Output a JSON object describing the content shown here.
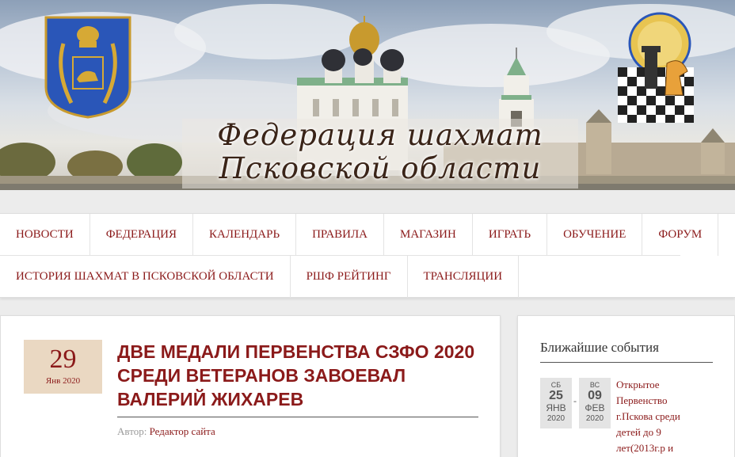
{
  "banner": {
    "title_line1": "Федерация шахмат",
    "title_line2": "Псковской области"
  },
  "nav": {
    "row1": [
      "НОВОСТИ",
      "ФЕДЕРАЦИЯ",
      "КАЛЕНДАРЬ",
      "ПРАВИЛА",
      "МАГАЗИН",
      "ИГРАТЬ",
      "ОБУЧЕНИЕ",
      "ФОРУМ"
    ],
    "row2": [
      "ИСТОРИЯ ШАХМАТ В ПСКОВСКОЙ ОБЛАСТИ",
      "РШФ РЕЙТИНГ",
      "ТРАНСЛЯЦИИ"
    ]
  },
  "article": {
    "day": "29",
    "month_year": "Янв 2020",
    "title": "ДВЕ МЕДАЛИ ПЕРВЕНСТВА СЗФО 2020 СРЕДИ ВЕТЕРАНОВ ЗАВОЕВАЛ ВАЛЕРИЙ ЖИХАРЕВ",
    "author_label": "Автор:",
    "author": "Редактор сайта"
  },
  "sidebar": {
    "title": "Ближайшие события",
    "event": {
      "start": {
        "dow": "СБ",
        "day": "25",
        "month": "ЯНВ",
        "year": "2020"
      },
      "separator": "-",
      "end": {
        "dow": "ВС",
        "day": "09",
        "month": "ФЕВ",
        "year": "2020"
      },
      "text": "Открытое Первенство г.Пскова среди детей до 9 лет(2013г.р и"
    }
  },
  "colors": {
    "accent": "#8b1a1a",
    "date_box": "#ead8c2",
    "event_date_bg": "#e4e4e4"
  }
}
